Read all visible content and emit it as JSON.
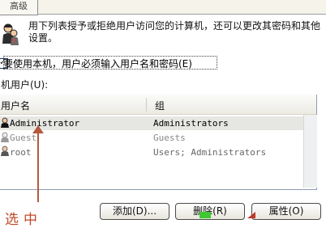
{
  "tabs": {
    "advanced": "高级"
  },
  "description": "用下列表授予或拒绝用户访问您的计算机，还可以更改其密码和其他设置。",
  "checkbox": {
    "label": "要使用本机，用户必须输入用户名和密码(E)",
    "checked": true
  },
  "users_label": "机用户(U):",
  "table": {
    "columns": [
      "用户名",
      "组"
    ],
    "rows": [
      {
        "user": "Administrator",
        "group": "Administrators",
        "selected": true
      },
      {
        "user": "Guest",
        "group": "Guests",
        "selected": false
      },
      {
        "user": "root",
        "group": "Users; Administrators",
        "selected": false
      }
    ]
  },
  "buttons": {
    "add": "添加(D)...",
    "delete": "删除(R)",
    "properties": "属性(O)"
  },
  "annotation": {
    "text": "选中",
    "color": "#c0492a"
  }
}
